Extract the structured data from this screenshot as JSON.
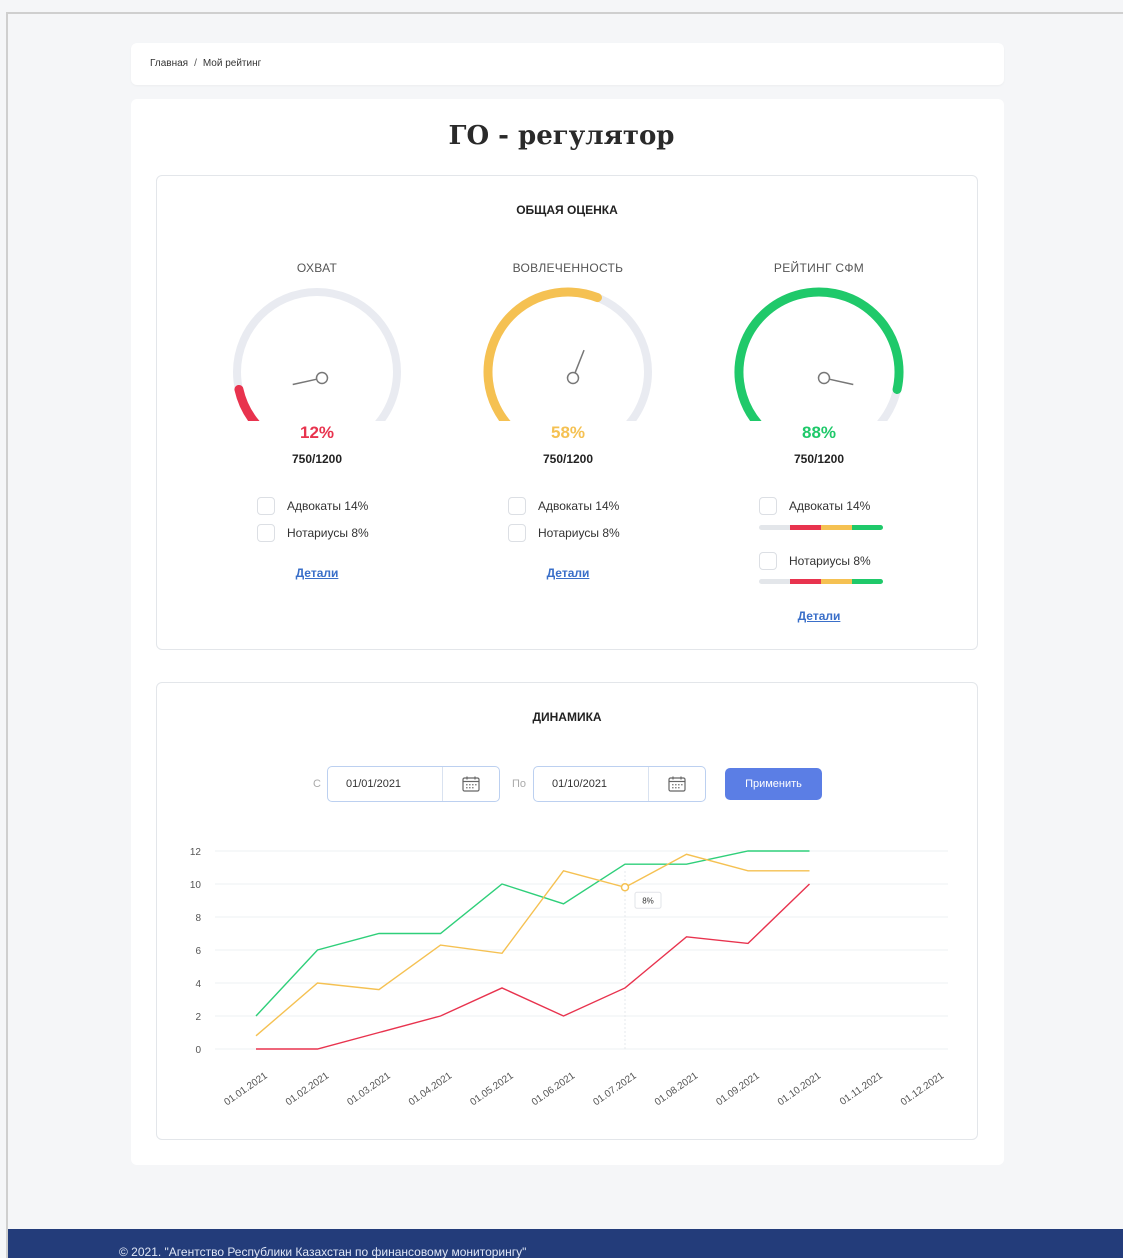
{
  "breadcrumb": {
    "home": "Главная",
    "separator": "/",
    "current": "Мой рейтинг"
  },
  "page_title": "ГО - регулятор",
  "overall": {
    "title": "ОБЩАЯ ОЦЕНКА",
    "gauges": [
      {
        "label": "ОХВАТ",
        "percent_text": "12%",
        "percent": 12,
        "score": "750/1200",
        "color": "#e8334e",
        "items": [
          "Адвокаты 14%",
          "Нотариусы 8%"
        ],
        "details": "Детали"
      },
      {
        "label": "ВОВЛЕЧЕННОСТЬ",
        "percent_text": "58%",
        "percent": 58,
        "score": "750/1200",
        "color": "#f5c152",
        "items": [
          "Адвокаты 14%",
          "Нотариусы 8%"
        ],
        "details": "Детали"
      },
      {
        "label": "РЕЙТИНГ СФМ",
        "percent_text": "88%",
        "percent": 88,
        "score": "750/1200",
        "color": "#1fc96a",
        "items": [
          "Адвокаты 14%",
          "Нотариусы 8%"
        ],
        "details": "Детали"
      }
    ],
    "track_color": "#e9ebf1",
    "bar_colors": [
      "#e3e6ea",
      "#e8334e",
      "#f5c152",
      "#1fc96a"
    ]
  },
  "dynamics": {
    "title": "ДИНАМИКА",
    "from_label": "С",
    "from_value": "01/01/2021",
    "to_label": "По",
    "to_value": "01/10/2021",
    "apply_label": "Применить",
    "calendar_icon": "calendar-icon"
  },
  "chart_data": {
    "type": "line",
    "x": [
      "01.01.2021",
      "01.02.2021",
      "01.03.2021",
      "01.04.2021",
      "01.05.2021",
      "01.06.2021",
      "01.07.2021",
      "01.08.2021",
      "01.09.2021",
      "01.10.2021",
      "01.11.2021",
      "01.12.2021"
    ],
    "yticks": [
      0,
      2,
      4,
      6,
      8,
      10,
      12
    ],
    "ylim": [
      0,
      12
    ],
    "grid": true,
    "series": [
      {
        "color": "#2fcf7a",
        "values": [
          2,
          6,
          7,
          7,
          10,
          8.8,
          11.2,
          11.2,
          12,
          12
        ]
      },
      {
        "color": "#f5c152",
        "values": [
          0.8,
          4,
          3.6,
          6.3,
          5.8,
          10.8,
          9.8,
          11.8,
          10.8,
          10.8
        ]
      },
      {
        "color": "#e8334e",
        "values": [
          0,
          0,
          1,
          2,
          3.7,
          2,
          3.7,
          6.8,
          6.4,
          10
        ]
      }
    ],
    "tooltip": {
      "text": "8%",
      "x": "01.07.2021"
    }
  },
  "footer": {
    "text": "© 2021. \"Агентство Республики Казахстан по финансовому мониторингу\""
  }
}
